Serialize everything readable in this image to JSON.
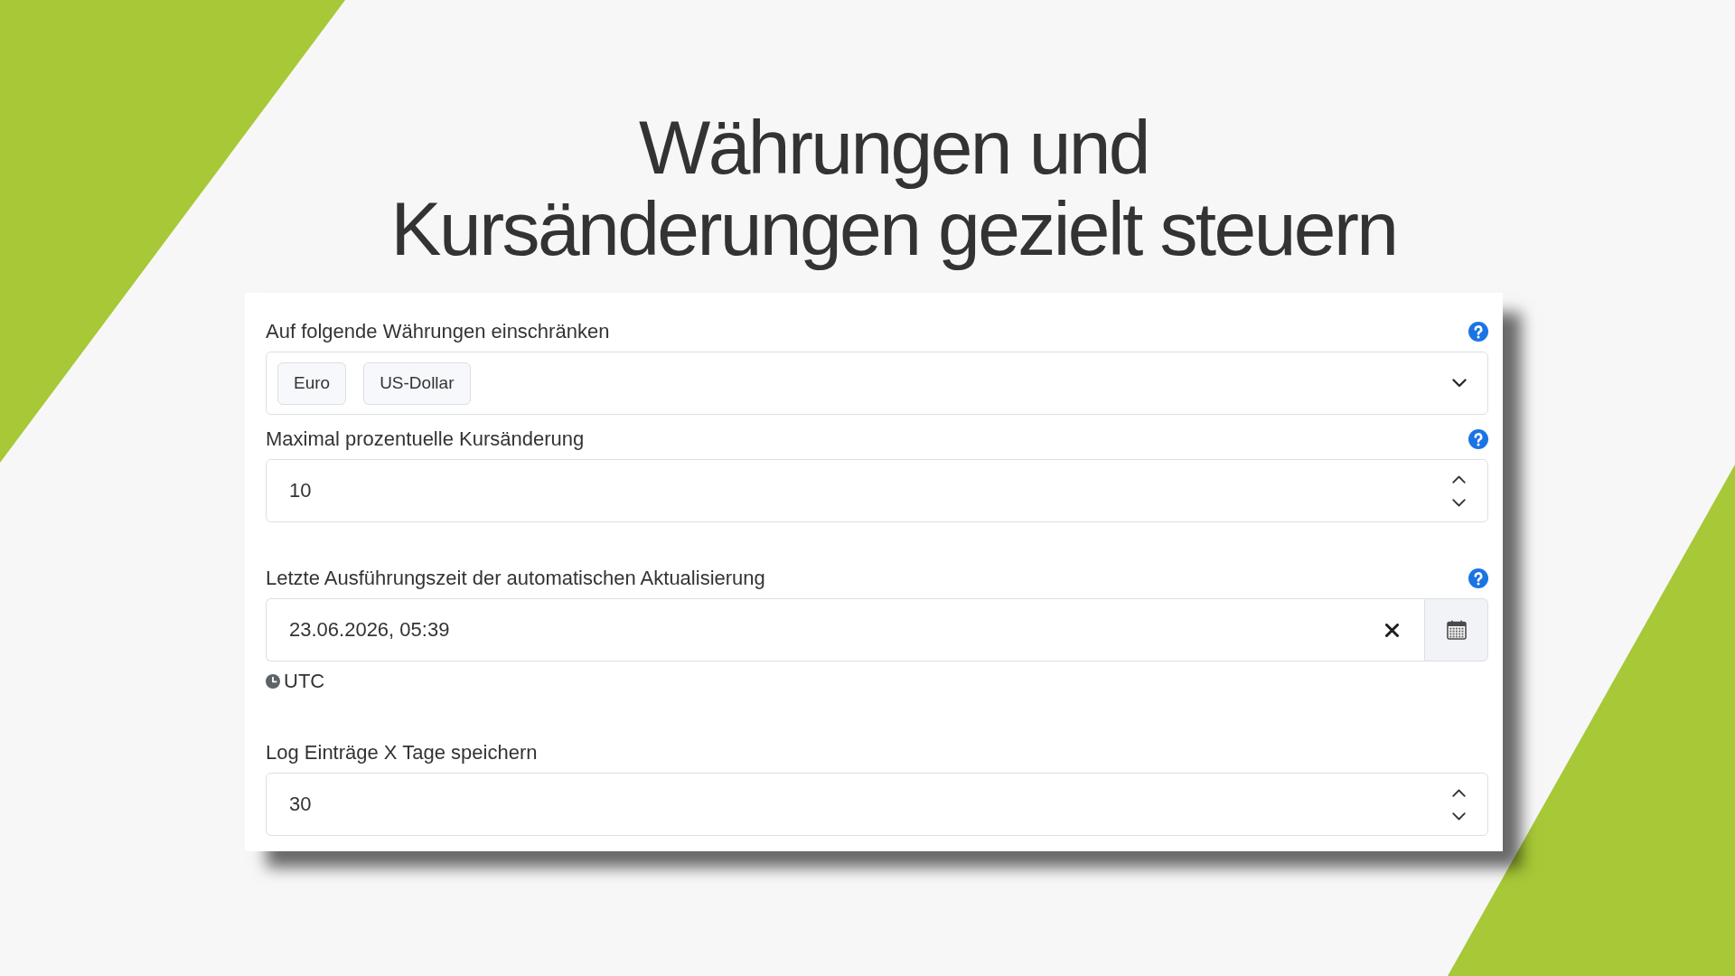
{
  "title_lines": [
    "Währungen und",
    "Kursänderungen gezielt steuern"
  ],
  "form": {
    "fields": [
      {
        "kind": "multiselect",
        "label": "Auf folgende Währungen einschränken",
        "help": true,
        "chips": [
          "Euro",
          "US-Dollar"
        ]
      },
      {
        "kind": "number",
        "label": "Maximal prozentuelle Kursänderung",
        "help": true,
        "value": "10"
      },
      {
        "kind": "datetime",
        "label": "Letzte Ausführungszeit der automatischen Aktualisierung",
        "help": true,
        "value": "23.06.2026, 05:39",
        "timezone": "UTC"
      },
      {
        "kind": "number",
        "label": "Log Einträge X Tage speichern",
        "help": false,
        "value": "30"
      }
    ]
  }
}
